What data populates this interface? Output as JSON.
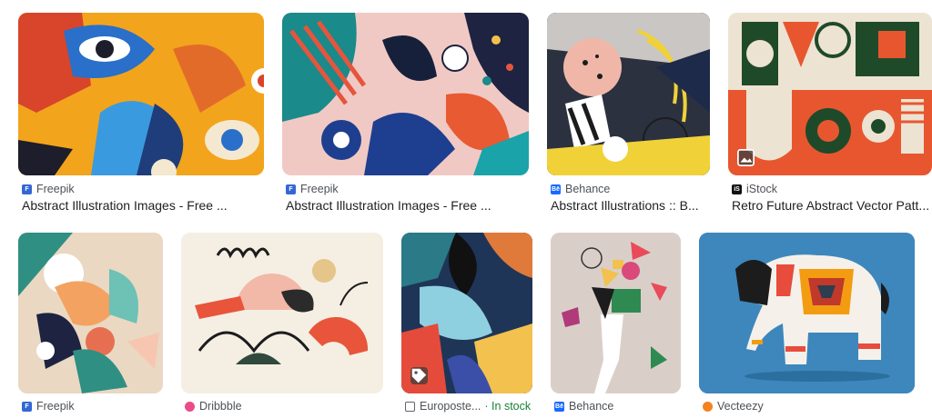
{
  "results": [
    {
      "source": "Freepik",
      "title": "Abstract Illustration Images - Free ...",
      "favicon": "freepik-icon",
      "color": "#3367d6"
    },
    {
      "source": "Freepik",
      "title": "Abstract Illustration Images - Free ...",
      "favicon": "freepik-icon",
      "color": "#3367d6"
    },
    {
      "source": "Behance",
      "title": "Abstract Illustrations :: B...",
      "favicon": "behance-icon",
      "color": "#1769ff"
    },
    {
      "source": "iStock",
      "title": "Retro Future Abstract Vector Patt...",
      "favicon": "istock-icon",
      "color": "#111111"
    },
    {
      "source": "Freepik",
      "favicon": "freepik-icon",
      "color": "#3367d6"
    },
    {
      "source": "Dribbble",
      "favicon": "dribbble-icon",
      "color": "#ea4c89"
    },
    {
      "source": "Europoste...",
      "stock": "· In stock",
      "favicon": "europoster-icon",
      "color": "#5f6368"
    },
    {
      "source": "Behance",
      "favicon": "behance-icon",
      "color": "#1769ff"
    },
    {
      "source": "Vecteezy",
      "favicon": "vecteezy-icon",
      "color": "#f58220"
    }
  ]
}
